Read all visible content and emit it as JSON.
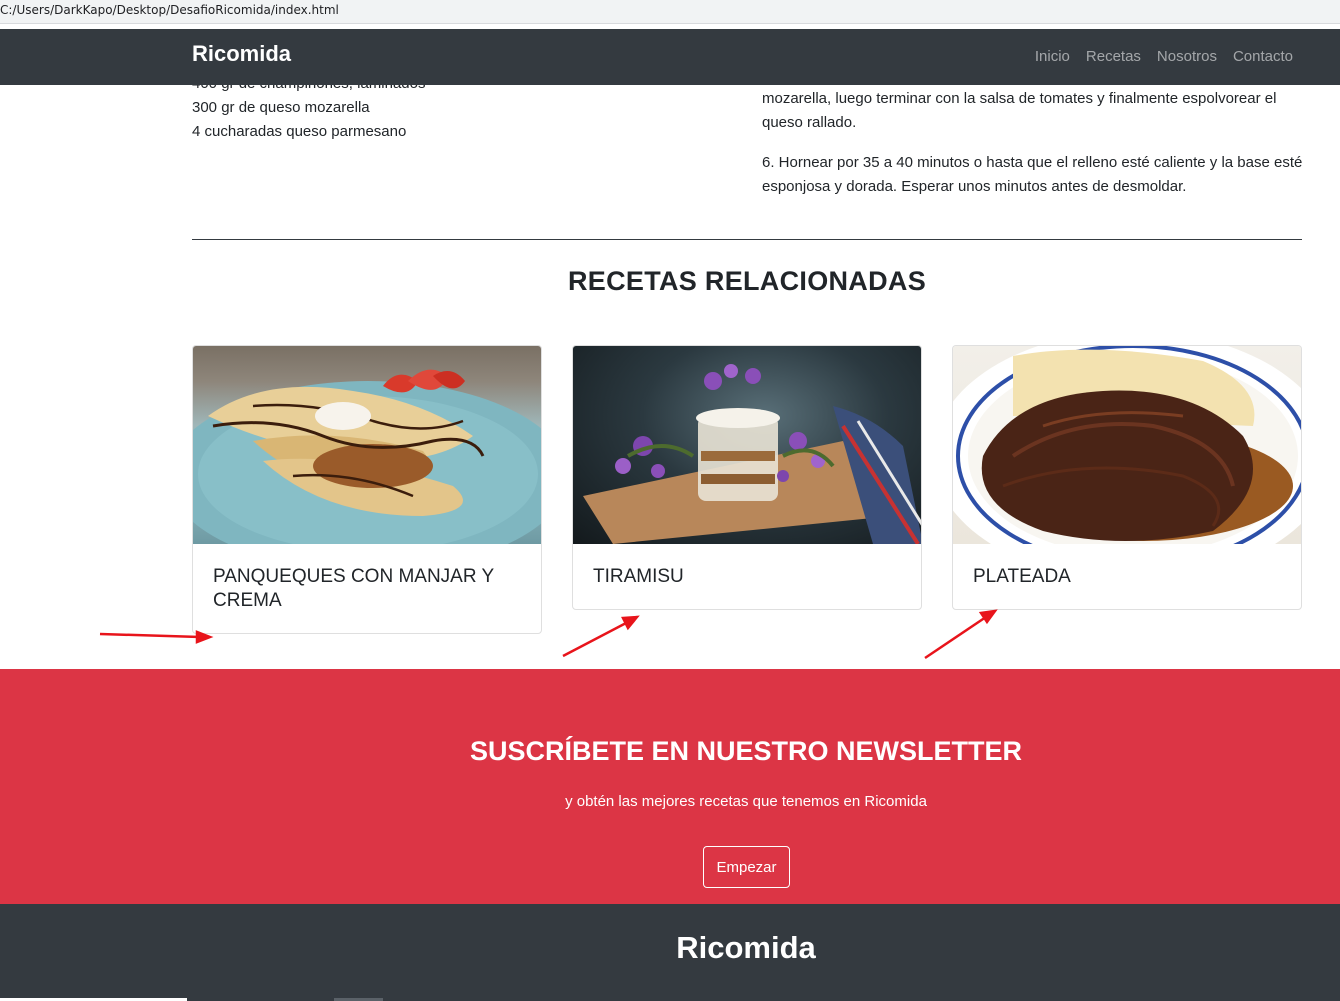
{
  "browser": {
    "address": "C:/Users/DarkKapo/Desktop/DesafioRicomida/index.html"
  },
  "navbar": {
    "brand": "Ricomida",
    "links": [
      "Inicio",
      "Recetas",
      "Nosotros",
      "Contacto"
    ]
  },
  "recipe": {
    "ingredients_visible": [
      "400 gr de champiñones, laminados",
      "300 gr de queso mozarella",
      "4 cucharadas queso parmesano"
    ],
    "steps_visible": [
      "mozarella, luego terminar con la salsa de tomates y finalmente espolvorear el queso rallado.",
      "6. Hornear por 35 a 40 minutos o hasta que el relleno esté caliente y la base esté esponjosa y dorada. Esperar unos minutos antes de desmoldar."
    ]
  },
  "related": {
    "title": "RECETAS RELACIONADAS",
    "cards": [
      {
        "title": "PANQUEQUES CON MANJAR Y CREMA",
        "image": "pancakes-photo"
      },
      {
        "title": "TIRAMISU",
        "image": "tiramisu-photo"
      },
      {
        "title": "PLATEADA",
        "image": "plateada-photo"
      }
    ]
  },
  "newsletter": {
    "title": "SUSCRÍBETE EN NUESTRO NEWSLETTER",
    "subtitle": "y obtén las mejores recetas que tenemos en Ricomida",
    "button": "Empezar"
  },
  "footer": {
    "brand": "Ricomida"
  },
  "colors": {
    "navbar": "#343a40",
    "newsletter": "#dc3545",
    "annotation_arrow": "#e8141b"
  }
}
